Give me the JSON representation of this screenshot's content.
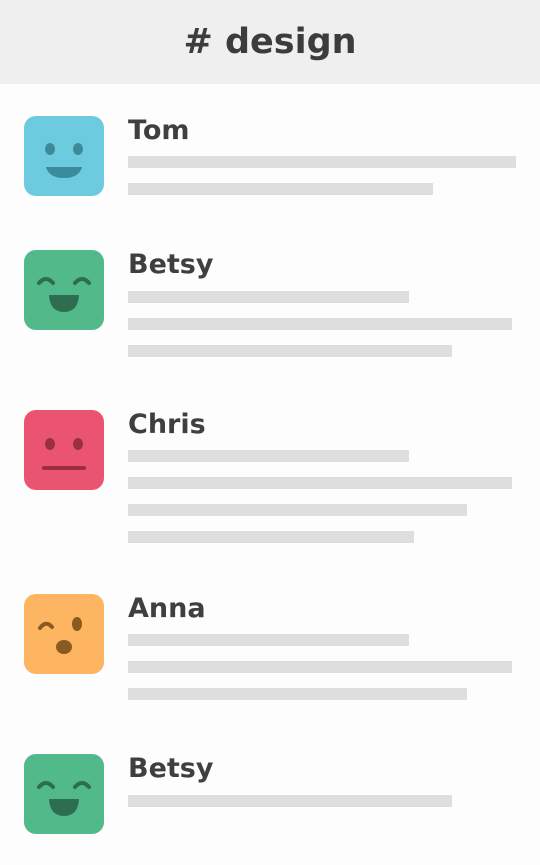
{
  "header": {
    "title": "# design"
  },
  "colors": {
    "header_bg": "#efefef",
    "text_line": "#dedede",
    "author_text": "#3f3f3f"
  },
  "messages": [
    {
      "author": "Tom",
      "avatar": {
        "color": "#6ccbdf",
        "face": "smile-icon"
      },
      "text_lines": 2
    },
    {
      "author": "Betsy",
      "avatar": {
        "color": "#52b98a",
        "face": "grin-icon"
      },
      "text_lines": 3
    },
    {
      "author": "Chris",
      "avatar": {
        "color": "#ea5470",
        "face": "neutral-icon"
      },
      "text_lines": 4
    },
    {
      "author": "Anna",
      "avatar": {
        "color": "#fdb561",
        "face": "surprised-wink-icon"
      },
      "text_lines": 3
    },
    {
      "author": "Betsy",
      "avatar": {
        "color": "#52b98a",
        "face": "grin-icon"
      },
      "text_lines": 1
    }
  ]
}
